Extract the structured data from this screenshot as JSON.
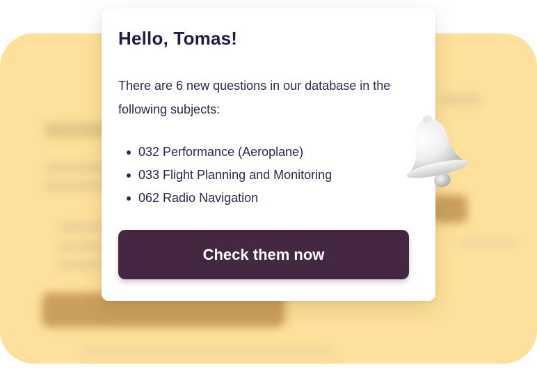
{
  "greeting": {
    "title": "Hello, Tomas!",
    "intro": "There are 6 new questions in our database in the following subjects:"
  },
  "subjects": [
    {
      "label": "032 Performance (Aeroplane)"
    },
    {
      "label": "033 Flight Planning and Monitoring"
    },
    {
      "label": "062 Radio Navigation"
    }
  ],
  "cta": {
    "label": "Check them now"
  },
  "icons": {
    "bell": "bell-icon"
  },
  "colors": {
    "background_card": "#fde09b",
    "button": "#442842",
    "title_text": "#1f1d47",
    "body_text": "#2a2850"
  }
}
